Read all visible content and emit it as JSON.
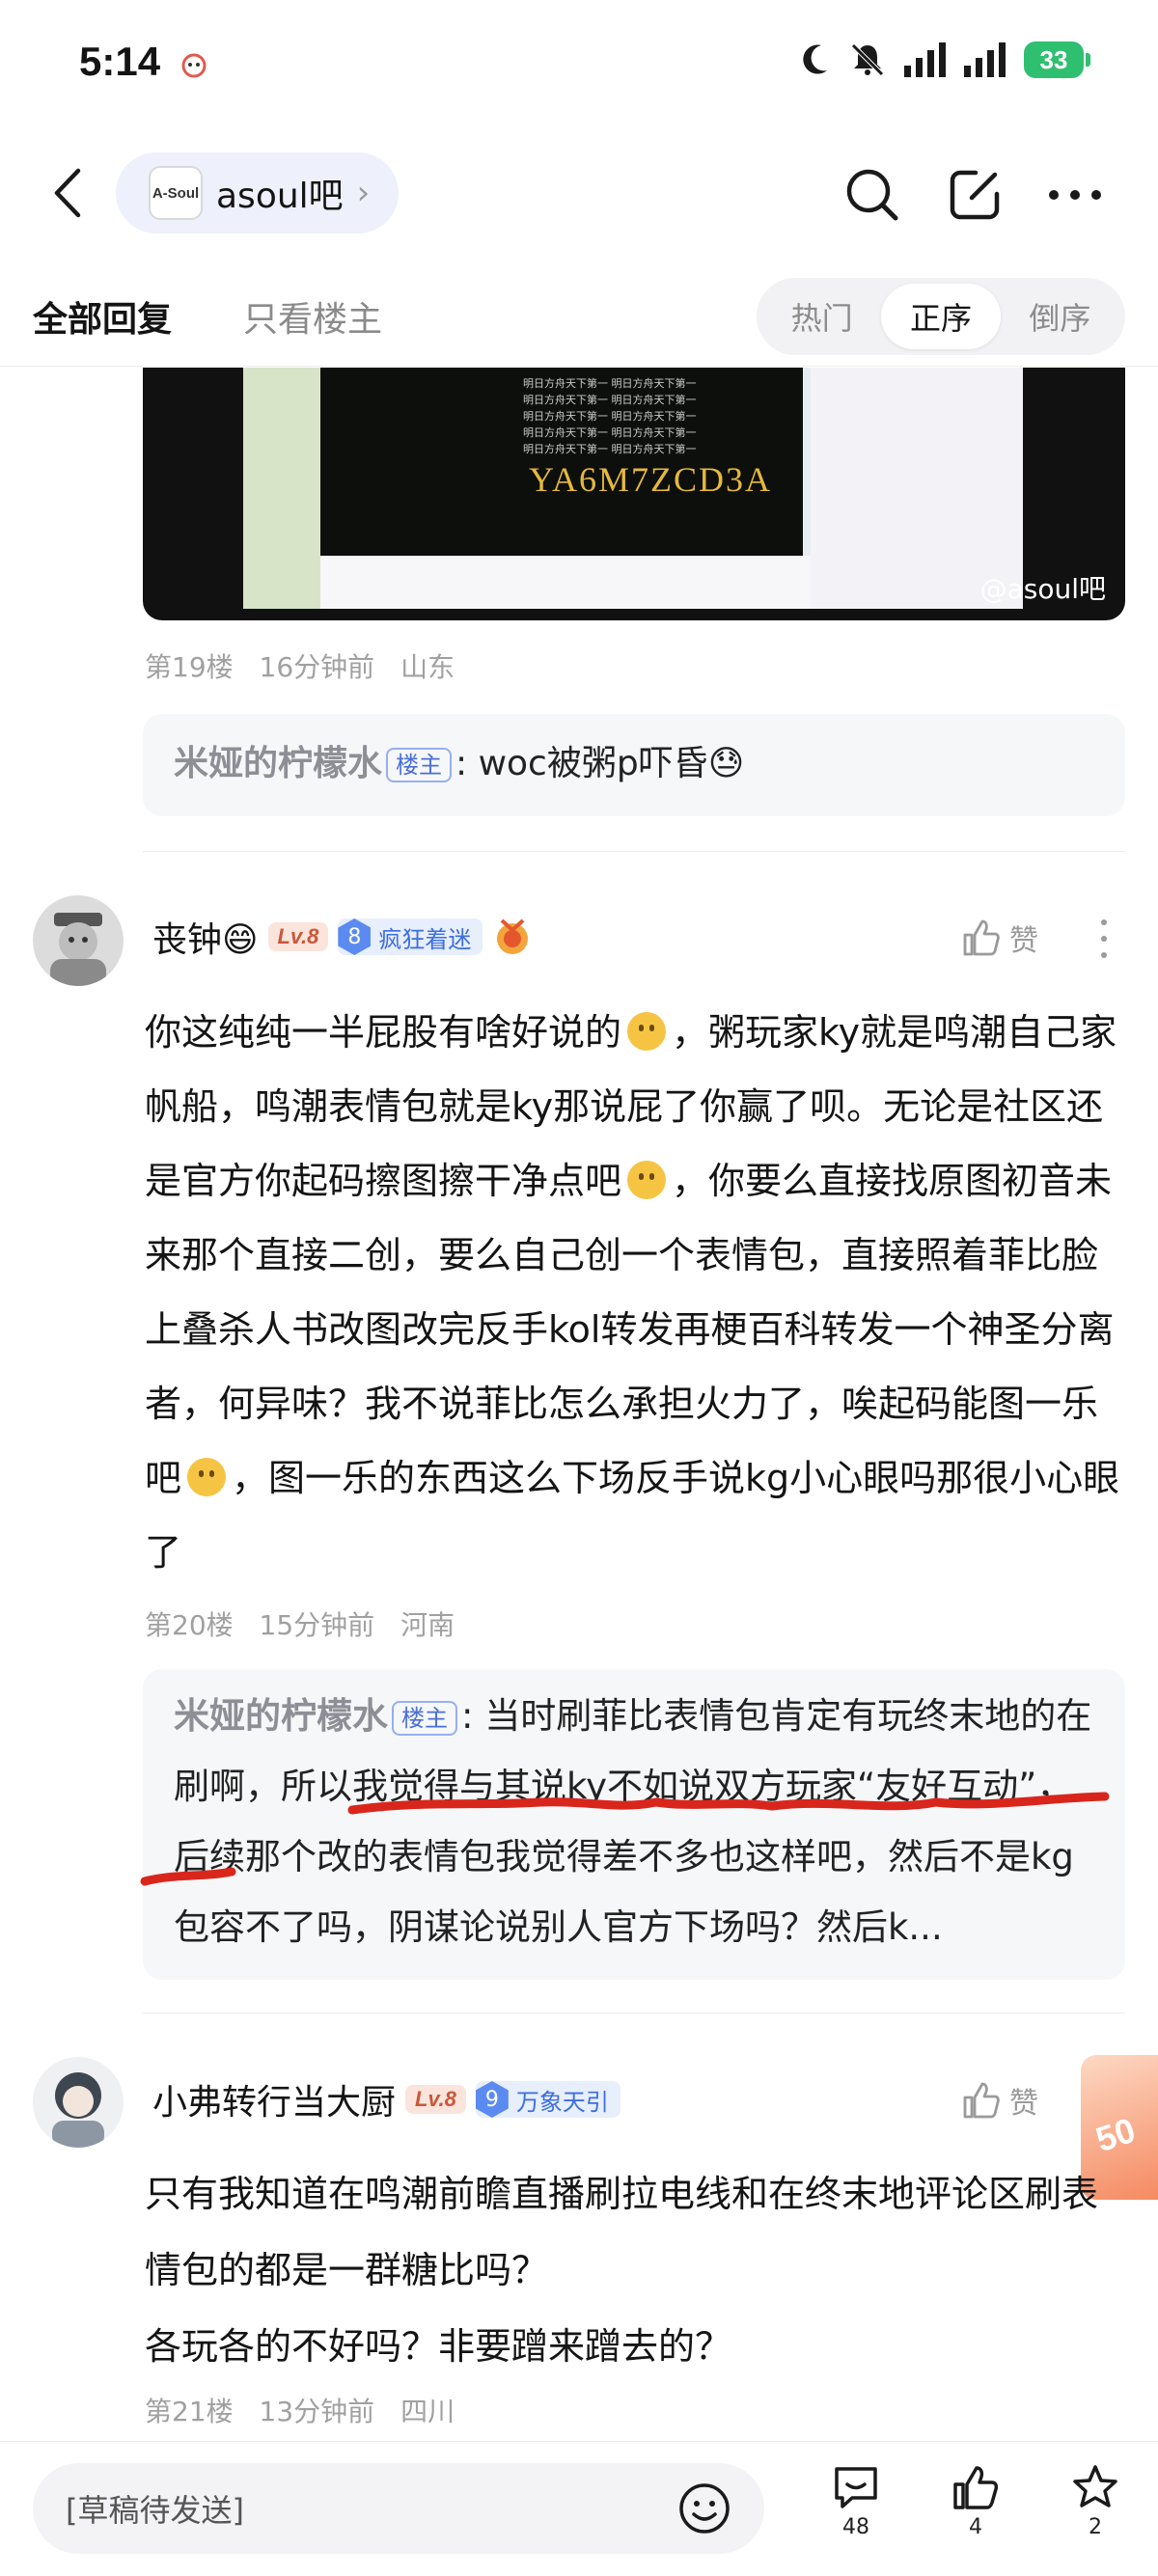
{
  "status": {
    "time": "5:14",
    "battery": "33"
  },
  "header": {
    "forum_name": "asoul吧",
    "forum_logo_text": "A-Soul"
  },
  "tabs": {
    "all_replies": "全部回复",
    "op_only": "只看楼主",
    "sort": [
      "热门",
      "正序",
      "倒序"
    ],
    "sort_active": "正序"
  },
  "video": {
    "code_text": "YA6M7ZCD3A",
    "watermark": "@asoul吧",
    "scroll_lines": [
      "明日方舟天下第一  明日方舟天下第一",
      "明日方舟天下第一 明日方舟天下第一",
      "明日方舟天下第一  明日方舟天下第一",
      "明日方舟天下第一 明日方舟天下第一",
      "明日方舟天下第一  明日方舟天下第一"
    ]
  },
  "floor19": {
    "meta": {
      "floor": "第19楼",
      "time": "16分钟前",
      "location": "山东"
    },
    "reply": {
      "user": "米娅的柠檬水",
      "badge": "楼主",
      "text": ": woc被粥p吓昏😓"
    }
  },
  "floor20": {
    "user": "丧钟😄",
    "level": "Lv.8",
    "fan_level": "8",
    "fan_title": "疯狂着迷",
    "like_label": "赞",
    "body_parts": [
      "你这纯纯一半屁股有啥好说的",
      "，粥玩家ky就是鸣潮自己家帆船，鸣潮表情包就是ky那说屁了你赢了呗。无论是社区还是官方你起码擦图擦干净点吧",
      "，你要么直接找原图初音未来那个直接二创，要么自己创一个表情包，直接照着菲比脸上叠杀人书改图改完反手kol转发再梗百科转发一个神圣分离者，何异味？我不说菲比怎么承担火力了，唉起码能图一乐吧",
      "，图一乐的东西这么下场反手说kg小心眼吗那很小心眼了"
    ],
    "meta": {
      "floor": "第20楼",
      "time": "15分钟前",
      "location": "河南"
    },
    "reply": {
      "user": "米娅的柠檬水",
      "badge": "楼主",
      "text": ": 当时刷菲比表情包肯定有玩终末地的在刷啊，所以我觉得与其说ky不如说双方玩家“友好互动”，后续那个改的表情包我觉得差不多也这样吧，然后不是kg包容不了吗，阴谋论说别人官方下场吗？然后k..."
    }
  },
  "floor21": {
    "user": "小弗转行当大厨",
    "level": "Lv.8",
    "fan_level": "9",
    "fan_title": "万象天引",
    "like_label": "赞",
    "body": "只有我知道在鸣潮前瞻直播刷拉电线和在终末地评论区刷表情包的都是一群糖比吗？\n各玩各的不好吗？非要蹭来蹭去的？",
    "meta": {
      "floor": "第21楼",
      "time": "13分钟前",
      "location": "四川"
    },
    "float_text": "50"
  },
  "bottom": {
    "draft_placeholder": "[草稿待发送]",
    "comments": "48",
    "likes": "4",
    "favorites": "2"
  },
  "colors": {
    "accent_blue": "#4a6fd6",
    "battery_green": "#2fbf71",
    "scribble_red": "#d9261c"
  }
}
